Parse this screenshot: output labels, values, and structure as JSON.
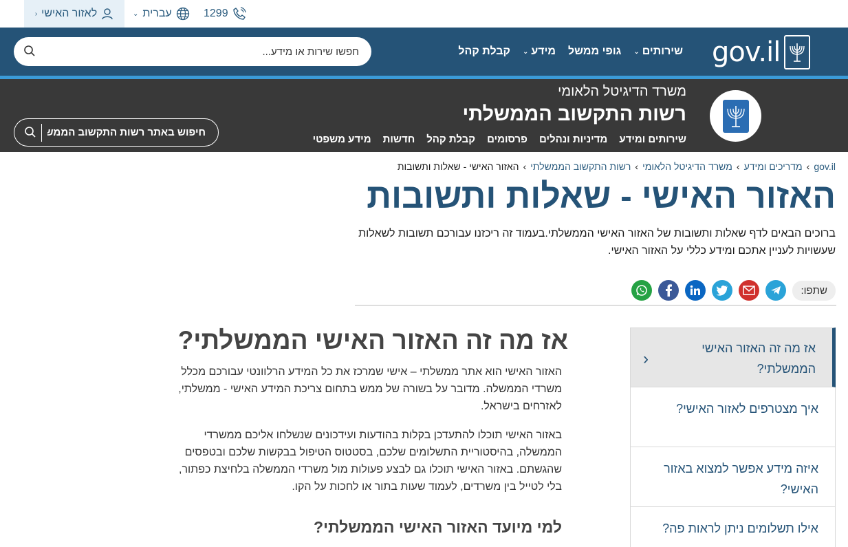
{
  "topbar": {
    "personal_area": "לאזור האישי",
    "language": "עברית",
    "phone": "1299"
  },
  "govbar": {
    "logo_text": "gov.il",
    "search_placeholder": "חפשו שירות או מידע...",
    "nav": [
      {
        "label": "שירותים",
        "has_dropdown": true
      },
      {
        "label": "גופי ממשל",
        "has_dropdown": false
      },
      {
        "label": "מידע",
        "has_dropdown": true
      },
      {
        "label": "קבלת קהל",
        "has_dropdown": false
      }
    ]
  },
  "ministry": {
    "parent": "משרד הדיגיטל הלאומי",
    "name": "רשות התקשוב הממשלתי",
    "nav": [
      "שירותים ומידע",
      "מדיניות ונהלים",
      "פרסומים",
      "קבלת קהל",
      "חדשות",
      "מידע משפטי"
    ],
    "search_placeholder": "חיפוש באתר רשות התקשוב הממש.."
  },
  "breadcrumb": [
    "gov.il",
    "מדריכים ומידע",
    "משרד הדיגיטל הלאומי",
    "רשות התקשוב הממשלתי",
    "האזור האישי - שאלות ותשובות"
  ],
  "page": {
    "title": "האזור האישי - שאלות ותשובות",
    "intro": "ברוכים הבאים לדף שאלות ותשובות של האזור האישי הממשלתי.בעמוד זה ריכזנו עבורכם תשובות לשאלות שעשויות לעניין אתכם ומידע כללי על האזור האישי.",
    "share_label": "שתפו:"
  },
  "share_icons": [
    {
      "name": "telegram-icon",
      "color": "#2aa3d8"
    },
    {
      "name": "email-icon",
      "color": "#d0312d"
    },
    {
      "name": "twitter-icon",
      "color": "#2aa3d8"
    },
    {
      "name": "linkedin-icon",
      "color": "#0a66c2"
    },
    {
      "name": "facebook-icon",
      "color": "#3b5998"
    },
    {
      "name": "whatsapp-icon",
      "color": "#25a244"
    }
  ],
  "side_menu": [
    "אז מה זה האזור האישי הממשלתי?",
    "איך מצטרפים לאזור האישי?",
    "איזה מידע אפשר למצוא באזור האישי?",
    "אילו תשלומים ניתן לראות פה?"
  ],
  "article": {
    "heading": "אז מה זה האזור האישי הממשלתי?",
    "p1": "האזור האישי הוא אתר ממשלתי – אישי שמרכז את כל המידע הרלוונטי עבורכם מכלל משרדי הממשלה. מדובר על בשורה של ממש בתחום צריכת המידע האישי - ממשלתי, לאזרחים בישראל.",
    "p2": "באזור האישי תוכלו להתעדכן בקלות בהודעות ועידכונים שנשלחו אליכם ממשרדי הממשלה, בהיסטוריית התשלומים שלכם, בסטטוס הטיפול בבקשות שלכם ובטפסים שהגשתם. באזור האישי תוכלו גם לבצע פעולות מול משרדי הממשלה בלחיצת כפתור, בלי לטייל בין משרדים, לעמוד שעות בתור או לחכות על הקו.",
    "subheading": "למי מיועד האזור האישי הממשלתי?"
  },
  "colors": {
    "gov_blue": "#255377",
    "accent_line": "#3b9bd8",
    "ministry_bg": "#393939"
  }
}
